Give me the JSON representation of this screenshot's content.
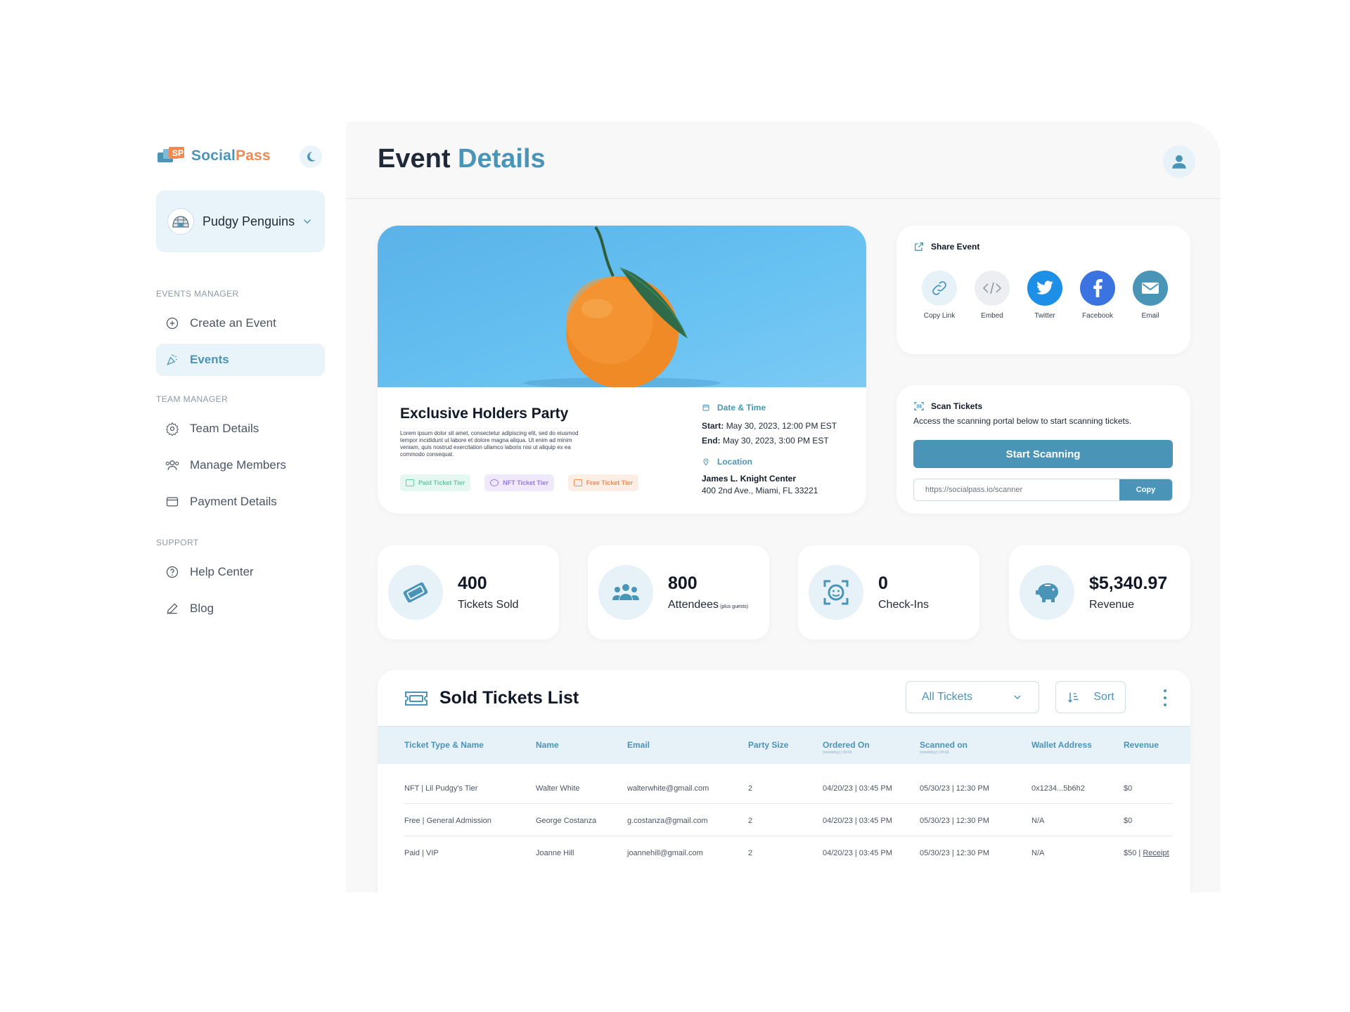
{
  "brand": {
    "name_part1": "Social",
    "name_part2": "Pass",
    "accent": "#4a94b8",
    "accent2": "#ee8a52"
  },
  "sidebar": {
    "team_name": "Pudgy Penguins",
    "sections": {
      "events_manager": "EVENTS MANAGER",
      "team_manager": "TEAM MANAGER",
      "support": "SUPPORT"
    },
    "items": {
      "create_event": "Create an Event",
      "events": "Events",
      "team_details": "Team Details",
      "manage_members": "Manage Members",
      "payment_details": "Payment Details",
      "help_center": "Help Center",
      "blog": "Blog"
    }
  },
  "header": {
    "title_part1": "Event",
    "title_part2": "Details"
  },
  "event": {
    "title": "Exclusive Holders Party",
    "description": "Lorem ipsum dolor sit amet, consectetur adipiscing elit, sed do eiusmod tempor incididunt ut labore et dolore magna aliqua. Ut enim ad minim veniam, quis nostrud exercitation ullamco laboris nisi ut aliquip ex ea commodo consequat.",
    "tiers": {
      "paid": "Paid Ticket Tier",
      "nft": "NFT Ticket Tier",
      "free": "Free Ticket Tier"
    },
    "date_heading": "Date & Time",
    "start_label": "Start:",
    "start_value": "May 30, 2023, 12:00 PM EST",
    "end_label": "End:",
    "end_value": "May 30, 2023, 3:00 PM EST",
    "location_heading": "Location",
    "venue": "James L. Knight Center",
    "address": "400 2nd Ave., Miami, FL 33221"
  },
  "share": {
    "title": "Share Event",
    "items": {
      "copy_link": "Copy Link",
      "embed": "Embed",
      "twitter": "Twitter",
      "facebook": "Facebook",
      "email": "Email"
    },
    "colors": {
      "twitter": "#1d8fe6",
      "facebook": "#3b74e0",
      "email": "#4a94b8"
    }
  },
  "scan": {
    "title": "Scan Tickets",
    "text": "Access the scanning portal below to start scanning tickets.",
    "button": "Start Scanning",
    "url": "https://socialpass.io/scanner",
    "copy": "Copy"
  },
  "stats": {
    "tickets": {
      "value": "400",
      "label": "Tickets Sold"
    },
    "attendees": {
      "value": "800",
      "label": "Attendees",
      "note": "(plus guests)"
    },
    "checkins": {
      "value": "0",
      "label": "Check-Ins"
    },
    "revenue": {
      "value": "$5,340.97",
      "label": "Revenue"
    }
  },
  "tickets_list": {
    "title": "Sold Tickets List",
    "filter": "All Tickets",
    "sort": "Sort",
    "columns": {
      "type": "Ticket Type & Name",
      "name": "Name",
      "email": "Email",
      "party": "Party Size",
      "ordered": "Ordered On",
      "ordered_sub": "(mm/dd/yy) | 00:00",
      "scanned": "Scanned on",
      "scanned_sub": "(mm/dd/yy) | 00:00",
      "wallet": "Wallet Address",
      "revenue": "Revenue"
    },
    "rows": [
      {
        "type": "NFT | Lil Pudgy's Tier",
        "name": "Walter White",
        "email": "walterwhite@gmail.com",
        "party": "2",
        "ordered": "04/20/23 | 03:45 PM",
        "scanned": "05/30/23 | 12:30 PM",
        "wallet": "0x1234...5b6h2",
        "revenue": "$0"
      },
      {
        "type": "Free | General Admission",
        "name": "George Costanza",
        "email": "g.costanza@gmail.com",
        "party": "2",
        "ordered": "04/20/23 | 03:45 PM",
        "scanned": "05/30/23 | 12:30 PM",
        "wallet": "N/A",
        "revenue": "$0"
      },
      {
        "type": "Paid | VIP",
        "name": "Joanne Hill",
        "email": "joannehill@gmail.com",
        "party": "2",
        "ordered": "04/20/23 | 03:45 PM",
        "scanned": "05/30/23 | 12:30 PM",
        "wallet": "N/A",
        "revenue": "$50 |",
        "receipt": "Receipt"
      }
    ]
  }
}
